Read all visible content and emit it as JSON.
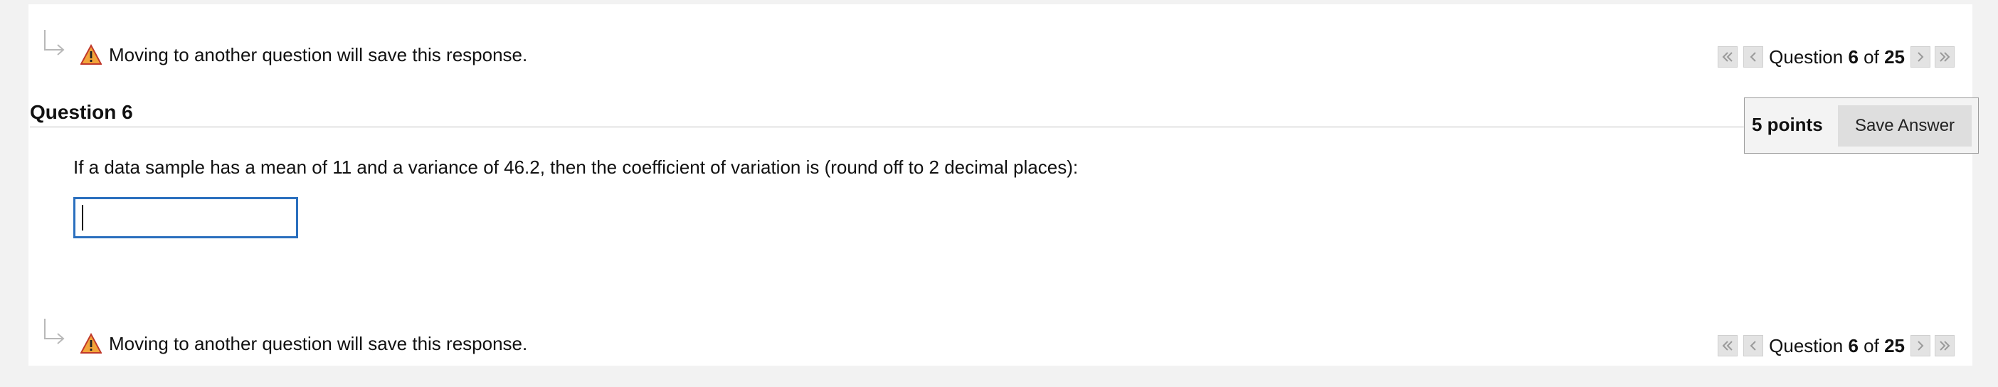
{
  "warning_text": "Moving to another question will save this response.",
  "nav": {
    "prefix": "Question",
    "current": "6",
    "of_label": "of",
    "total": "25"
  },
  "question": {
    "heading": "Question 6",
    "points": "5 points",
    "save_label": "Save Answer",
    "text": "If a data sample has a mean of 11 and a variance of 46.2, then the coefficient of variation is (round off to 2 decimal places):",
    "answer_value": ""
  },
  "colors": {
    "warning": "#f2a43a",
    "input_border": "#2a6fbe",
    "nav_button": "#e3e3e3"
  }
}
